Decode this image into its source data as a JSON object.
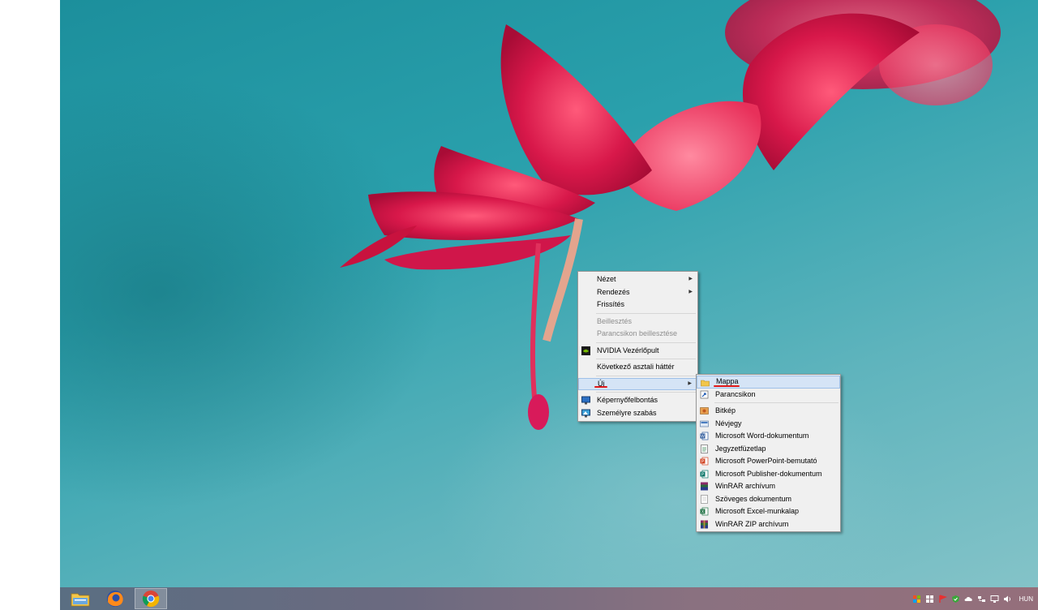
{
  "context_menu": {
    "items": [
      {
        "label": "Nézet",
        "submenu": true
      },
      {
        "label": "Rendezés",
        "submenu": true
      },
      {
        "label": "Frissítés"
      },
      {
        "label": "Beillesztés",
        "disabled": true
      },
      {
        "label": "Parancsikon beillesztése",
        "disabled": true
      },
      {
        "label": "NVIDIA Vezérlőpult",
        "icon": "nvidia-icon"
      },
      {
        "label": "Következő asztali háttér"
      },
      {
        "label": "Új",
        "submenu": true,
        "highlighted": true
      },
      {
        "label": "Képernyőfelbontás",
        "icon": "display-icon"
      },
      {
        "label": "Személyre szabás",
        "icon": "personalize-icon"
      }
    ]
  },
  "new_submenu": {
    "items": [
      {
        "label": "Mappa",
        "icon": "folder-icon",
        "highlighted": true
      },
      {
        "label": "Parancsikon",
        "icon": "shortcut-icon"
      },
      {
        "label": "Bitkép",
        "icon": "bitmap-icon"
      },
      {
        "label": "Névjegy",
        "icon": "contact-icon"
      },
      {
        "label": "Microsoft Word-dokumentum",
        "icon": "word-icon"
      },
      {
        "label": "Jegyzetfüzetlap",
        "icon": "journal-icon"
      },
      {
        "label": "Microsoft PowerPoint-bemutató",
        "icon": "powerpoint-icon"
      },
      {
        "label": "Microsoft Publisher-dokumentum",
        "icon": "publisher-icon"
      },
      {
        "label": "WinRAR archívum",
        "icon": "winrar-icon"
      },
      {
        "label": "Szöveges dokumentum",
        "icon": "text-document-icon"
      },
      {
        "label": "Microsoft Excel-munkalap",
        "icon": "excel-icon"
      },
      {
        "label": "WinRAR ZIP archívum",
        "icon": "winrar-zip-icon"
      }
    ]
  },
  "taskbar": {
    "pinned": [
      {
        "name": "file-explorer-icon"
      },
      {
        "name": "firefox-icon"
      },
      {
        "name": "chrome-icon",
        "active": true
      }
    ],
    "tray": {
      "icons": [
        "flag-icon",
        "windows-icon",
        "red-flag-icon",
        "shield-icon",
        "cloud-icon",
        "network-icon",
        "monitor-icon",
        "volume-icon"
      ],
      "language": "HUN"
    }
  },
  "colors": {
    "menu_background": "#f0f0f0",
    "menu_highlight": "#d5e4f6",
    "annotation_underline": "#e01818"
  }
}
